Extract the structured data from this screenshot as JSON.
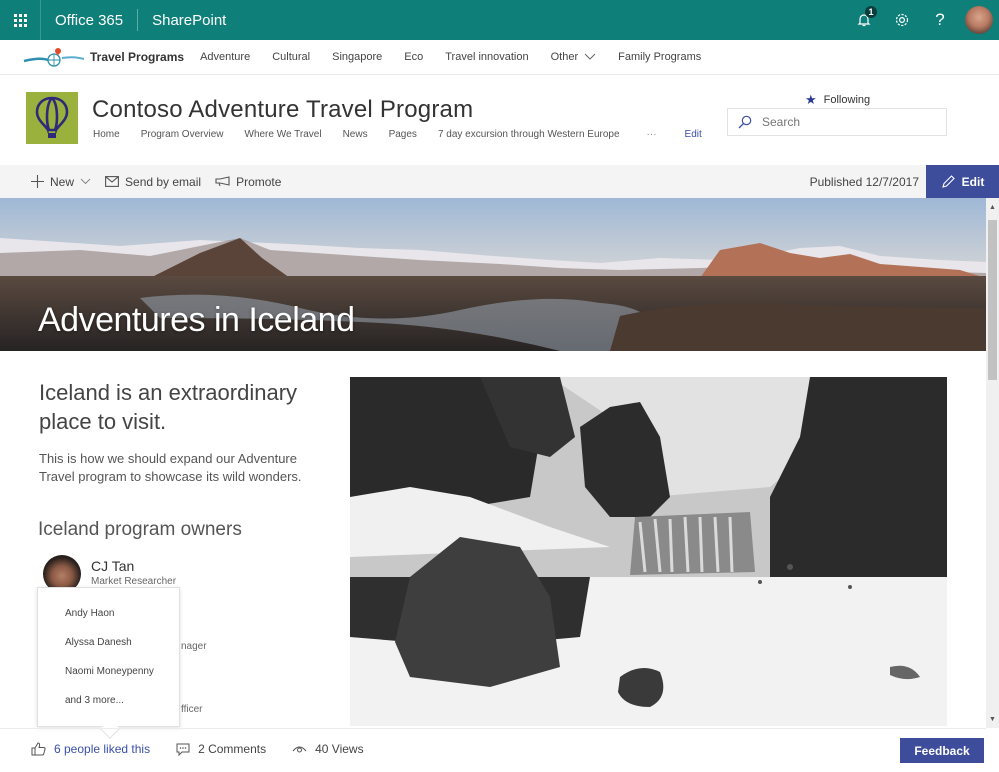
{
  "suitebar": {
    "app_name": "Office 365",
    "product_name": "SharePoint",
    "notification_count": "1",
    "icons": {
      "launcher": "waffle-icon",
      "notifications": "bell-icon",
      "settings": "gear-icon",
      "help": "question-icon",
      "profile": "avatar"
    },
    "brand_color": "#0f7f7a"
  },
  "hubnav": {
    "title": "Travel Programs",
    "items": [
      {
        "label": "Adventure"
      },
      {
        "label": "Cultural"
      },
      {
        "label": "Singapore"
      },
      {
        "label": "Eco"
      },
      {
        "label": "Travel innovation"
      },
      {
        "label": "Other",
        "has_dropdown": true
      },
      {
        "label": "Family Programs"
      }
    ]
  },
  "site": {
    "title": "Contoso Adventure Travel Program",
    "nav": [
      {
        "label": "Home"
      },
      {
        "label": "Program Overview"
      },
      {
        "label": "Where We Travel"
      },
      {
        "label": "News"
      },
      {
        "label": "Pages"
      },
      {
        "label": "7 day excursion through Western Europe"
      }
    ],
    "nav_more": "···",
    "nav_edit": "Edit",
    "following_label": "Following",
    "search_placeholder": "Search",
    "logo_color": "#9ab23d"
  },
  "commandbar": {
    "new_label": "New",
    "send_email_label": "Send by email",
    "promote_label": "Promote",
    "published_text": "Published 12/7/2017",
    "edit_label": "Edit",
    "accent_color": "#3d4d9c"
  },
  "hero": {
    "title": "Adventures in Iceland"
  },
  "content": {
    "intro_heading": "Iceland is an extraordinary place to visit.",
    "intro_text": "This is how we should expand our Adventure Travel program to showcase its wild wonders.",
    "owners_heading": "Iceland program owners",
    "owners": [
      {
        "name": "CJ Tan",
        "role": "Market Researcher"
      }
    ],
    "partial_roles": [
      "nager",
      "fficer"
    ]
  },
  "likes_popup": {
    "items": [
      {
        "label": "Andy Haon"
      },
      {
        "label": "Alyssa Danesh"
      },
      {
        "label": "Naomi Moneypenny"
      },
      {
        "label": "and 3 more..."
      }
    ]
  },
  "footer": {
    "likes_label": "6 people liked this",
    "comments_label": "2 Comments",
    "views_label": "40 Views",
    "feedback_label": "Feedback"
  }
}
